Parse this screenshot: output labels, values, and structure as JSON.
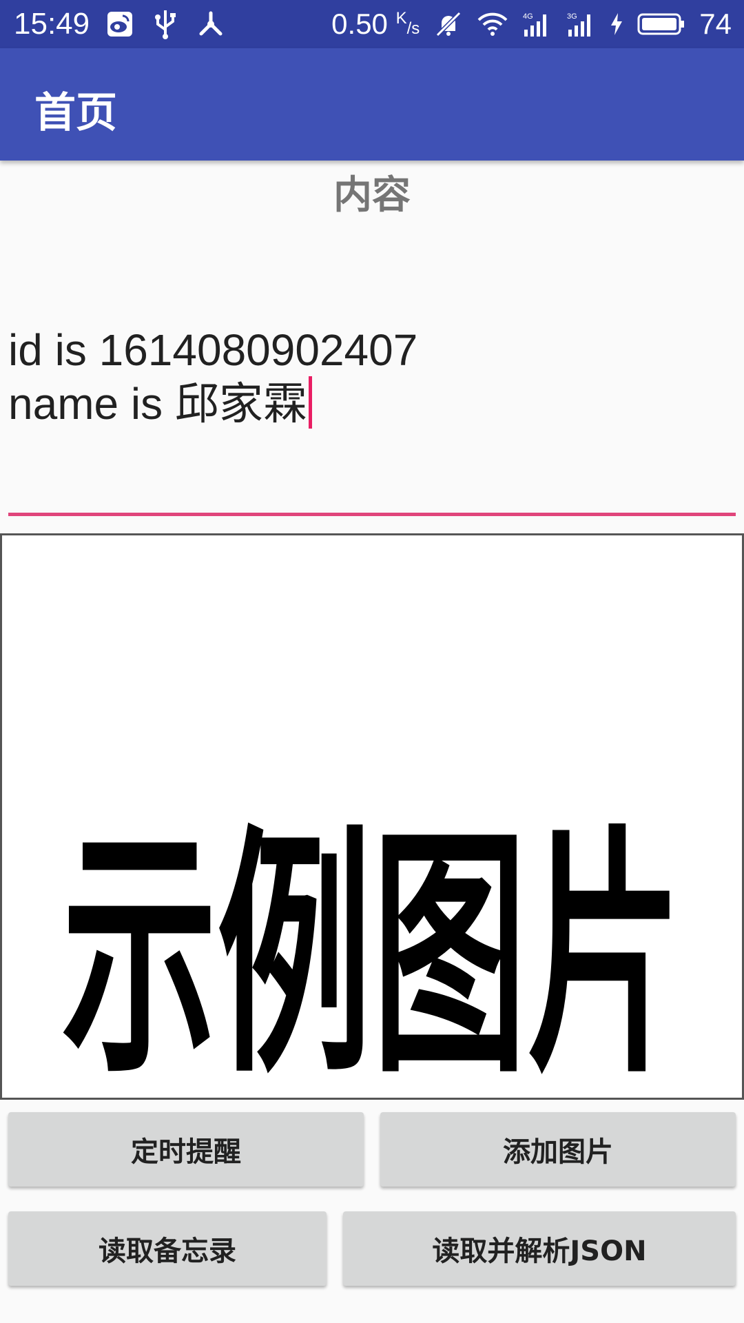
{
  "status_bar": {
    "time": "15:49",
    "speed_value": "0.50",
    "speed_unit_top": "K",
    "speed_unit_bottom": "/s",
    "battery_pct": "74",
    "left_icons": [
      "weibo-icon",
      "usb-icon",
      "share-hub-icon"
    ],
    "right_icons": [
      "mute-bell-icon",
      "wifi-icon",
      "signal-4g-icon",
      "signal-3g-icon",
      "charging-icon",
      "battery-icon"
    ]
  },
  "app_bar": {
    "title": "首页",
    "color": "#3f51b5",
    "status_color": "#303f9f"
  },
  "content": {
    "heading": "内容",
    "text_line1": "id is 1614080902407",
    "text_line2": "name is 邱家霖",
    "accent_color": "#e91e63"
  },
  "image": {
    "text": "示例图片"
  },
  "buttons": {
    "timer": "定时提醒",
    "add_image": "添加图片",
    "read_memo": "读取备忘录",
    "read_json": "读取并解析JSON"
  }
}
